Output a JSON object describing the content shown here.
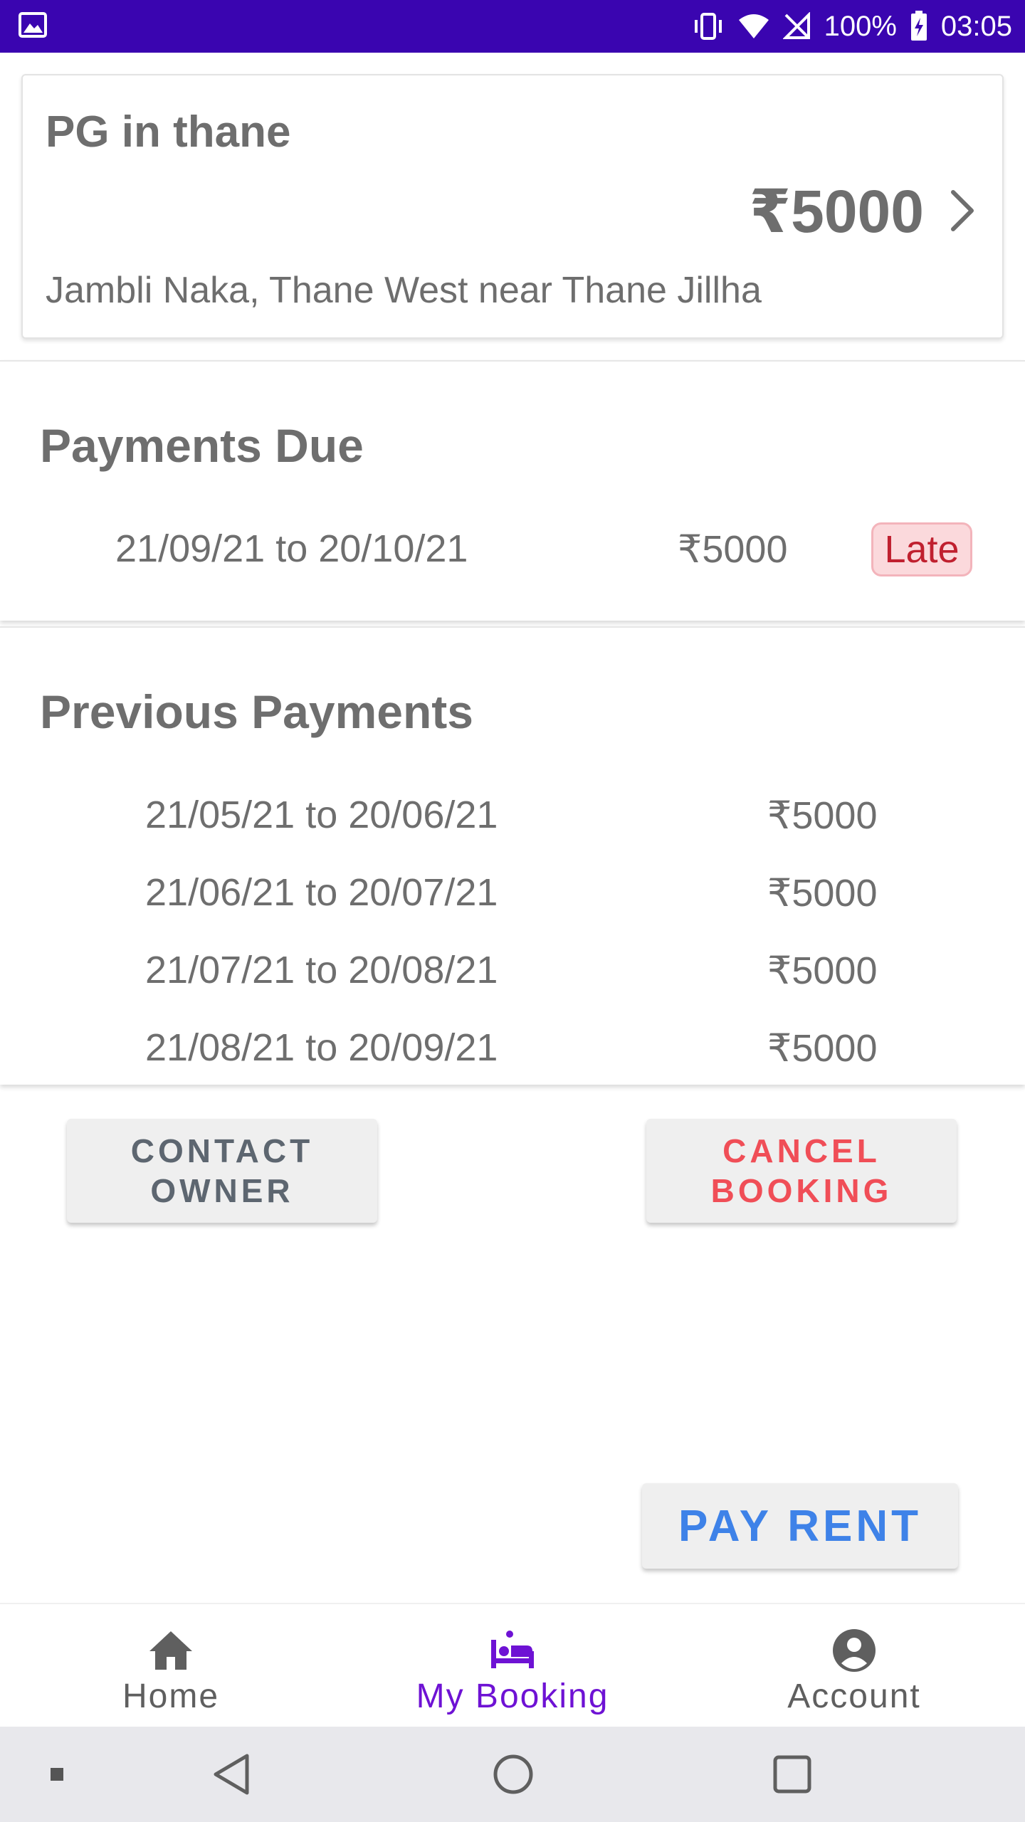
{
  "status_bar": {
    "battery": "100%",
    "time": "03:05",
    "icons": [
      "gallery-icon",
      "vibrate-icon",
      "wifi-icon",
      "no-sim-icon",
      "battery-charging-icon"
    ]
  },
  "property": {
    "title": "PG in thane",
    "price": "₹5000",
    "address": "Jambli Naka, Thane West near Thane Jillha"
  },
  "payments_due": {
    "title": "Payments Due",
    "items": [
      {
        "period": "21/09/21 to 20/10/21",
        "amount": "₹5000",
        "status": "Late"
      }
    ]
  },
  "previous_payments": {
    "title": "Previous Payments",
    "items": [
      {
        "period": "21/05/21 to 20/06/21",
        "amount": "₹5000"
      },
      {
        "period": "21/06/21 to 20/07/21",
        "amount": "₹5000"
      },
      {
        "period": "21/07/21 to 20/08/21",
        "amount": "₹5000"
      },
      {
        "period": "21/08/21 to 20/09/21",
        "amount": "₹5000"
      }
    ]
  },
  "actions": {
    "contact_owner": "CONTACT OWNER",
    "cancel_booking": "CANCEL BOOKING",
    "pay_rent": "PAY RENT"
  },
  "bottom_nav": {
    "items": [
      {
        "label": "Home",
        "icon": "home-icon",
        "active": false
      },
      {
        "label": "My Booking",
        "icon": "bed-icon",
        "active": true
      },
      {
        "label": "Account",
        "icon": "account-circle-icon",
        "active": false
      }
    ]
  },
  "colors": {
    "status_bar": "#3a05b0",
    "active_nav": "#6e12d4",
    "cancel": "#f04e57",
    "pay": "#3e82e8",
    "late_bg": "#fbd9dc",
    "late_text": "#c0202f"
  }
}
